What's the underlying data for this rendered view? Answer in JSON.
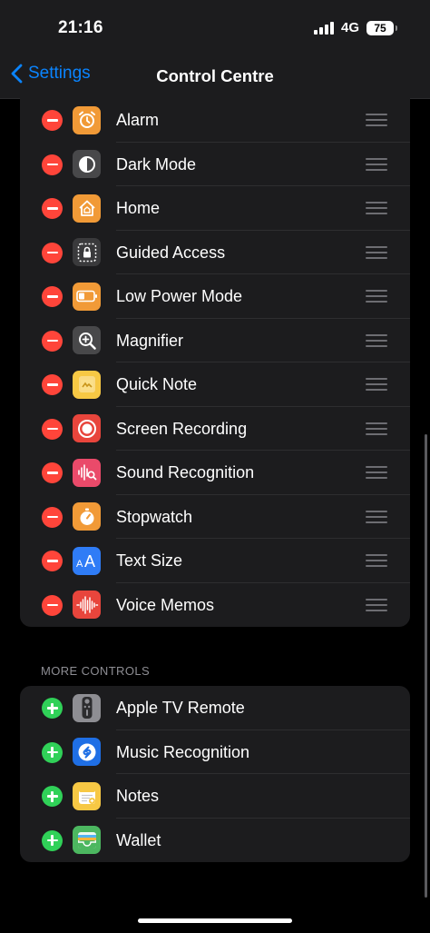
{
  "status": {
    "time": "21:16",
    "network": "4G",
    "battery": "75"
  },
  "nav": {
    "back_label": "Settings",
    "title": "Control Centre"
  },
  "included": [
    {
      "label": "Alarm",
      "icon": "alarm-icon",
      "color": "#f19a37"
    },
    {
      "label": "Dark Mode",
      "icon": "dark-mode-icon",
      "color": "#48484a"
    },
    {
      "label": "Home",
      "icon": "home-icon",
      "color": "#f19a37"
    },
    {
      "label": "Guided Access",
      "icon": "guided-access-icon",
      "color": "#3a3a3c"
    },
    {
      "label": "Low Power Mode",
      "icon": "battery-icon",
      "color": "#f19a37"
    },
    {
      "label": "Magnifier",
      "icon": "magnifier-icon",
      "color": "#48484a"
    },
    {
      "label": "Quick Note",
      "icon": "quick-note-icon",
      "color": "#f7c844"
    },
    {
      "label": "Screen Recording",
      "icon": "screen-recording-icon",
      "color": "#e8453c"
    },
    {
      "label": "Sound Recognition",
      "icon": "sound-recognition-icon",
      "color": "#ea4a6a"
    },
    {
      "label": "Stopwatch",
      "icon": "stopwatch-icon",
      "color": "#f19a37"
    },
    {
      "label": "Text Size",
      "icon": "text-size-icon",
      "color": "#2f7cf6"
    },
    {
      "label": "Voice Memos",
      "icon": "voice-memos-icon",
      "color": "#e8453c"
    }
  ],
  "more_header": "MORE CONTROLS",
  "more": [
    {
      "label": "Apple TV Remote",
      "icon": "tv-remote-icon",
      "color": "#8e8e93"
    },
    {
      "label": "Music Recognition",
      "icon": "shazam-icon",
      "color": "#1f6fe5"
    },
    {
      "label": "Notes",
      "icon": "notes-icon",
      "color": "#f7c844"
    },
    {
      "label": "Wallet",
      "icon": "wallet-icon",
      "color": "#4cb760"
    }
  ]
}
